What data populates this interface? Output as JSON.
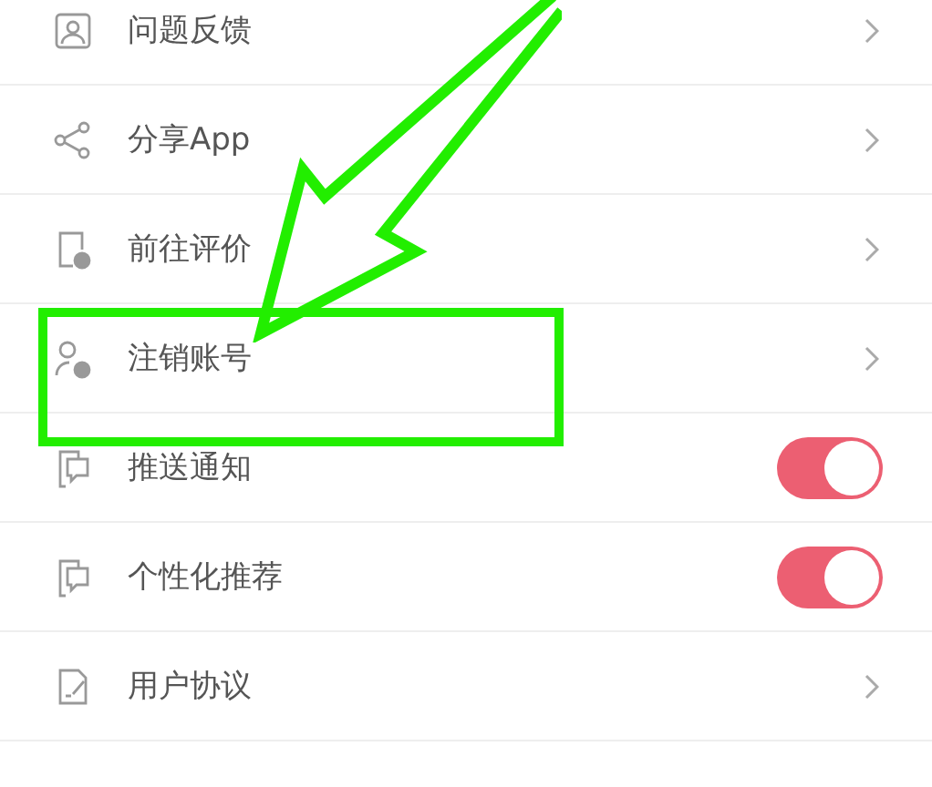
{
  "settings": [
    {
      "kind": "link",
      "label": "问题反馈",
      "highlighted": false
    },
    {
      "kind": "link",
      "label": "分享App",
      "highlighted": false
    },
    {
      "kind": "link",
      "label": "前往评价",
      "highlighted": false
    },
    {
      "kind": "link",
      "label": "注销账号",
      "highlighted": true
    },
    {
      "kind": "toggle",
      "label": "推送通知",
      "on": true,
      "highlighted": false
    },
    {
      "kind": "toggle",
      "label": "个性化推荐",
      "on": true,
      "highlighted": false
    },
    {
      "kind": "link",
      "label": "用户协议",
      "highlighted": false
    }
  ]
}
